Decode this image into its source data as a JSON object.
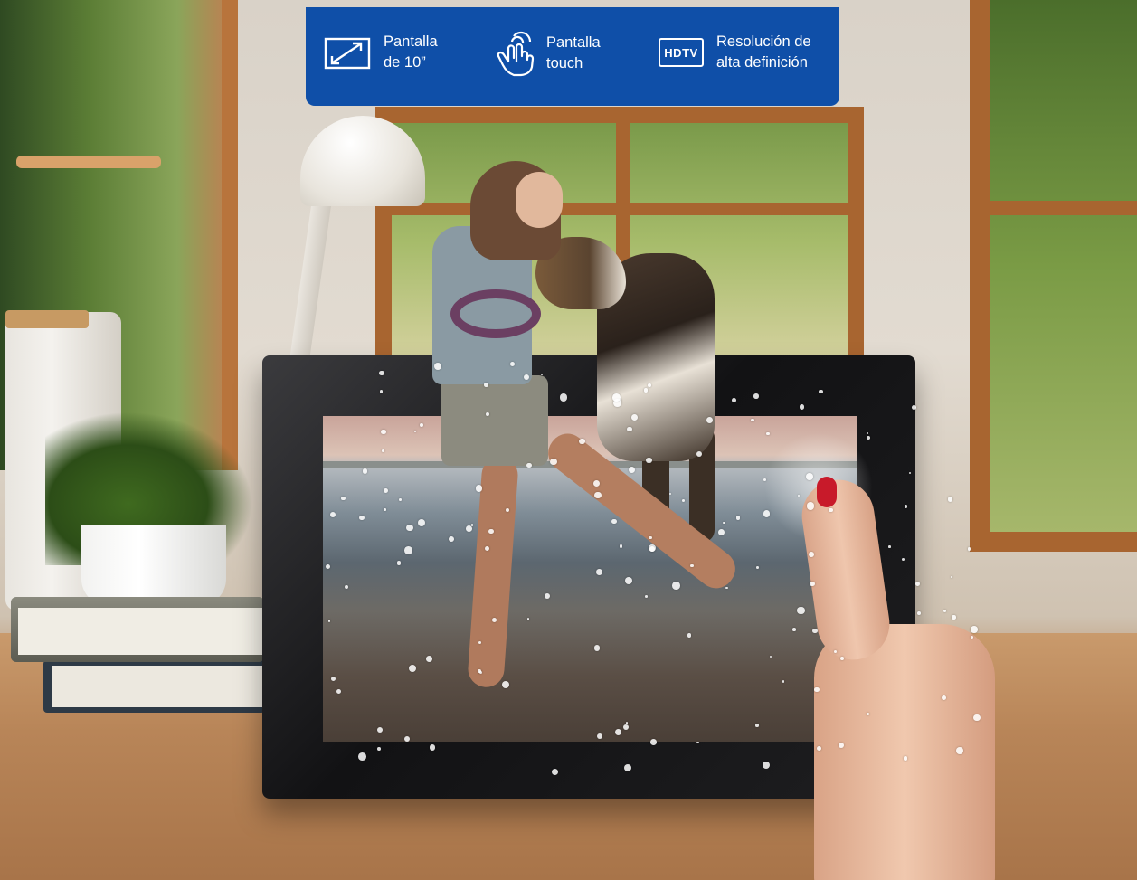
{
  "banner": {
    "background_color": "#0f4fa8",
    "features": [
      {
        "icon": "screen-size-icon",
        "line1": "Pantalla",
        "line2": "de 10”"
      },
      {
        "icon": "touch-hand-icon",
        "line1": "Pantalla",
        "line2": "touch"
      },
      {
        "icon": "hdtv-icon",
        "icon_text": "HDTV",
        "line1": "Resolución de",
        "line2": "alta definición"
      }
    ]
  },
  "product": {
    "frame_color": "#141416",
    "nail_color": "#c81a2a"
  }
}
